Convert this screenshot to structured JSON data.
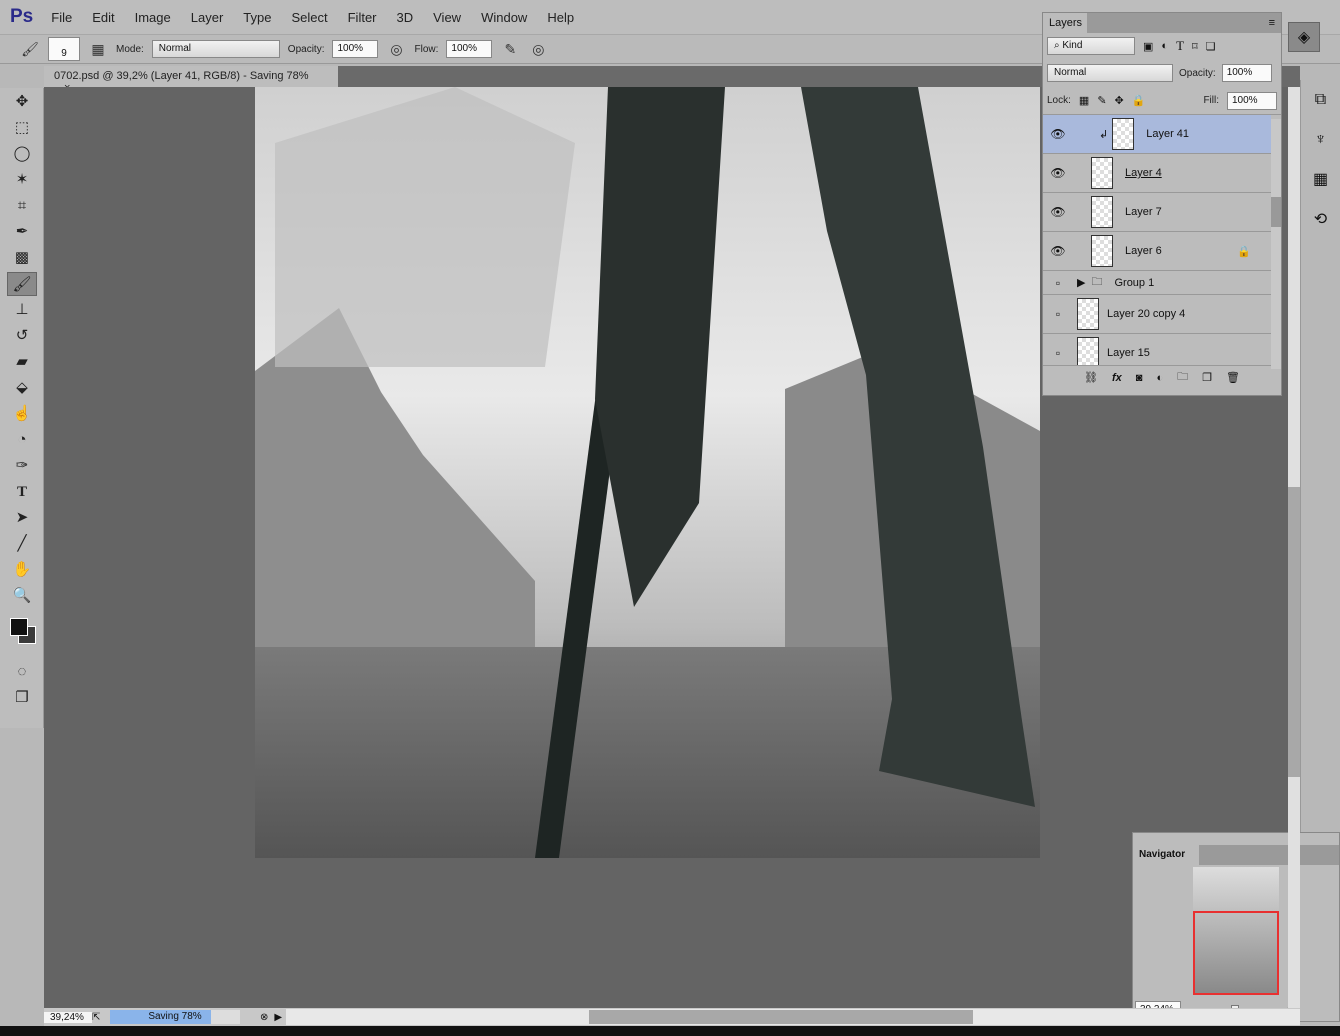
{
  "app": {
    "logo": "Ps"
  },
  "menu": [
    "File",
    "Edit",
    "Image",
    "Layer",
    "Type",
    "Select",
    "Filter",
    "3D",
    "View",
    "Window",
    "Help"
  ],
  "options": {
    "brush_size": "9",
    "mode_label": "Mode:",
    "mode": "Normal",
    "opacity_label": "Opacity:",
    "opacity": "100%",
    "flow_label": "Flow:",
    "flow": "100%"
  },
  "document": {
    "tab_title": "0702.psd @ 39,2% (Layer 41, RGB/8) - Saving 78%",
    "close": "×"
  },
  "tools": [
    "move",
    "marquee",
    "lasso",
    "magic-wand",
    "crop",
    "eyedropper",
    "healing",
    "brush",
    "clone-stamp",
    "history-brush",
    "eraser",
    "paint-bucket",
    "blur",
    "dodge",
    "pen",
    "type",
    "path-select",
    "line",
    "hand",
    "zoom"
  ],
  "layers_panel": {
    "title": "Layers",
    "filter": "Kind",
    "blend": "Normal",
    "opacity_label": "Opacity:",
    "opacity": "100%",
    "lock_label": "Lock:",
    "fill_label": "Fill:",
    "fill": "100%",
    "layers": [
      {
        "name": "Layer 41",
        "visible": true,
        "selected": true,
        "clipped": true
      },
      {
        "name": "Layer 4",
        "visible": true
      },
      {
        "name": "Layer 7",
        "visible": true
      },
      {
        "name": "Layer 6",
        "visible": true,
        "locked": true
      },
      {
        "name": "Group 1",
        "visible": false,
        "group": true
      },
      {
        "name": "Layer 20 copy 4",
        "visible": false
      },
      {
        "name": "Layer 15",
        "visible": false
      }
    ]
  },
  "navigator": {
    "title": "Navigator",
    "zoom": "39,24%"
  },
  "status": {
    "zoom": "39,24%",
    "progress_label": "Saving 78%",
    "progress": 0.78
  },
  "colors": {
    "selected_layer": "#a9b9dc",
    "progress": "#8ab4ea",
    "nav_frame": "#e83030"
  }
}
